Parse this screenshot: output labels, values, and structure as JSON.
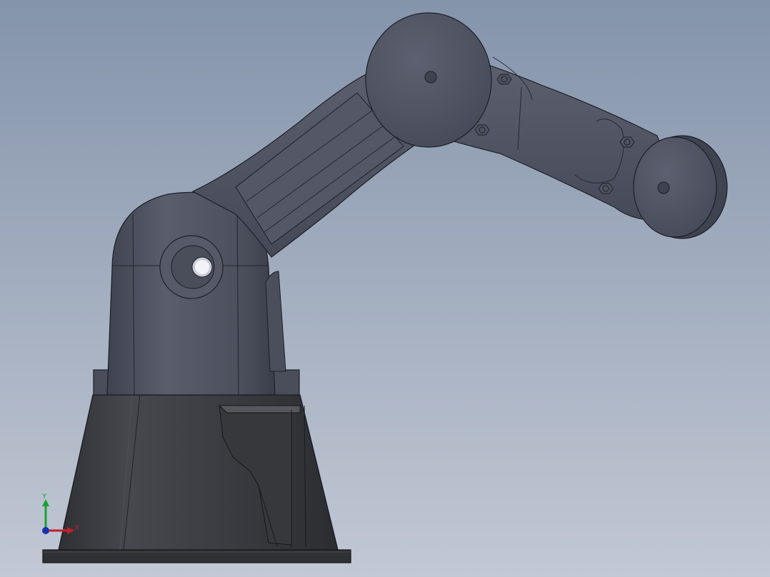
{
  "viewport": {
    "background_top": "#8494ab",
    "background_bottom": "#c2c8d4"
  },
  "model": {
    "body_color": "#4e5260",
    "base_color": "#3b3d42",
    "edge_color": "#1d1f26"
  },
  "triad": {
    "x_label": "X",
    "y_label": "Y",
    "x_color": "#c0202a",
    "y_color": "#1aa135",
    "z_color": "#1e2fb0"
  }
}
